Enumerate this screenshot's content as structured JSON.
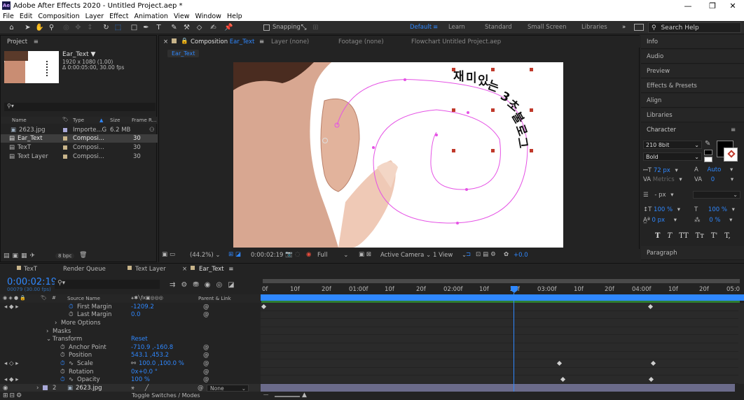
{
  "app": {
    "title": "Adobe After Effects 2020 - Untitled Project.aep *",
    "logo": "Ae",
    "window_controls": [
      "minimize-icon",
      "restore-icon",
      "close-icon"
    ]
  },
  "menu": [
    "File",
    "Edit",
    "Composition",
    "Layer",
    "Effect",
    "Animation",
    "View",
    "Window",
    "Help"
  ],
  "toolbar": {
    "snapping_label": "Snapping",
    "workspaces": [
      "Default",
      "Learn",
      "Standard",
      "Small Screen",
      "Libraries"
    ],
    "active_workspace": "Default",
    "search_placeholder": "Search Help"
  },
  "project": {
    "tab": "Project",
    "comp_name": "Ear_Text",
    "comp_info1": "1920 x 1080 (1.00)",
    "comp_info2": "Δ 0:00:05:00, 30.00 fps",
    "columns": [
      "Name",
      "Type",
      "Size",
      "Frame R..."
    ],
    "items": [
      {
        "name": "2623.jpg",
        "type": "Importe...G",
        "size": "6.2 MB",
        "frame": ""
      },
      {
        "name": "Ear_Text",
        "type": "Composi...",
        "size": "",
        "frame": "30"
      },
      {
        "name": "TexT",
        "type": "Composi...",
        "size": "",
        "frame": "30"
      },
      {
        "name": "Text Layer",
        "type": "Composi...",
        "size": "",
        "frame": "30"
      }
    ],
    "bpc": "8 bpc"
  },
  "viewer": {
    "comp_tab_prefix": "Composition",
    "comp_tab_name": "Ear_Text",
    "layer_tab": "Layer  (none)",
    "footage_tab": "Footage  (none)",
    "flowchart_tab": "Flowchart  Untitled Project.aep",
    "breadcrumb": "Ear_Text",
    "korean_chars": [
      "재",
      "미",
      "있",
      "는",
      "3",
      "초",
      "불",
      "로",
      "그"
    ],
    "zoom": "(44.2%)",
    "timecode": "0:00:02:19",
    "resolution": "Full",
    "camera": "Active Camera",
    "views": "1 View",
    "exposure": "+0.0"
  },
  "right_panels": [
    "Info",
    "Audio",
    "Preview",
    "Effects & Presets",
    "Align",
    "Libraries"
  ],
  "character": {
    "title": "Character",
    "font": "210 8bit",
    "style": "Bold",
    "size": "72 px",
    "leading": "Auto",
    "kerning": "Metrics",
    "tracking": "0",
    "stroke": "- px",
    "vscale": "100 %",
    "hscale": "100 %",
    "baseline": "0 px",
    "tsume": "0 %",
    "format_buttons": [
      "T",
      "T",
      "TT",
      "Tт",
      "T'",
      "T,"
    ],
    "paragraph": "Paragraph"
  },
  "timeline": {
    "tabs": [
      "TexT",
      "Render Queue",
      "Text Layer",
      "Ear_Text"
    ],
    "active_tab": "Ear_Text",
    "timecode": "0:00:02:19",
    "frames": "00079 (30.00 fps)",
    "ruler": [
      "0f",
      "10f",
      "20f",
      "01:00f",
      "10f",
      "20f",
      "02:00f",
      "10f",
      "20f",
      "03:00f",
      "10f",
      "20f",
      "04:00f",
      "10f",
      "20f",
      "05:0"
    ],
    "col_source": "Source Name",
    "col_parent": "Parent & Link",
    "properties": [
      {
        "name": "First Margin",
        "value": "-1209.2"
      },
      {
        "name": "Last Margin",
        "value": "0.0"
      },
      {
        "name": "More Options",
        "value": ""
      },
      {
        "name": "Masks",
        "value": ""
      },
      {
        "name": "Transform",
        "value": "Reset"
      },
      {
        "name": "Anchor Point",
        "value": "-710.9 ,-160.8"
      },
      {
        "name": "Position",
        "value": "543.1 ,453.2"
      },
      {
        "name": "Scale",
        "value": "100.0 ,100.0 %"
      },
      {
        "name": "Rotation",
        "value": "0x+0.0 °"
      },
      {
        "name": "Opacity",
        "value": "100 %"
      }
    ],
    "layer2_num": "2",
    "layer2_name": "2623.jpg",
    "layer2_parent": "None",
    "toggle_label": "Toggle Switches / Modes"
  }
}
